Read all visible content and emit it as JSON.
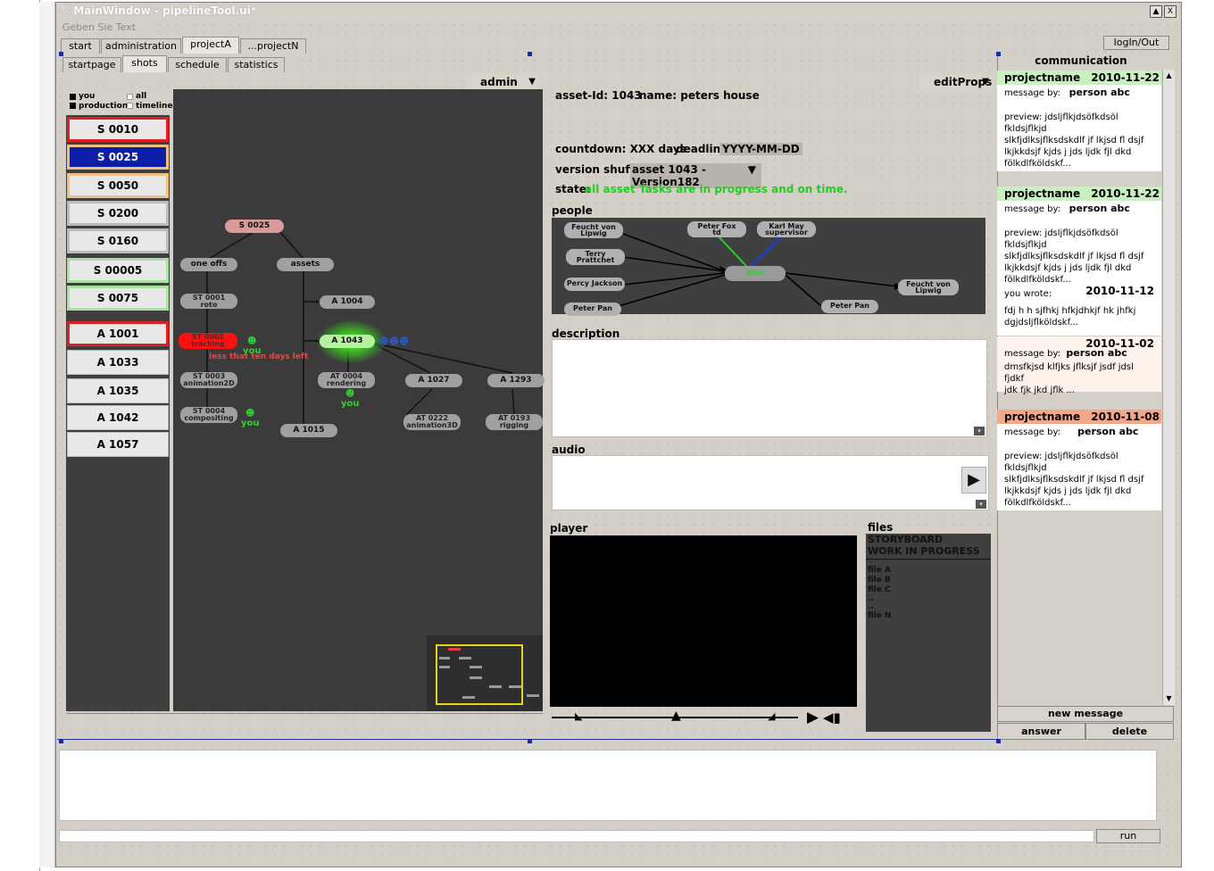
{
  "window": {
    "title": "MainWindow - pipelineTool.ui*",
    "top_lineedit_placeholder": "Geben Sie Text ein",
    "min_btn": "▲",
    "close_btn": "X"
  },
  "project_tabs": [
    "start",
    "administration",
    "projectA",
    "...projectN"
  ],
  "login_button": "logIn/Out",
  "sub_tabs": [
    "startpage",
    "shots",
    "schedule",
    "statistics"
  ],
  "legend": {
    "you": "you",
    "all": "all",
    "production": "production",
    "timeline": "timeline"
  },
  "shots": [
    {
      "label": "S 0010",
      "border": "#e02020",
      "bg": "#e8e8e8",
      "color": "#000"
    },
    {
      "label": "S 0025",
      "border": "#f0c080",
      "bg": "#0a1ea8",
      "color": "#ffffff"
    },
    {
      "label": "S 0050",
      "border": "#f0c080",
      "bg": "#e8e8e8",
      "color": "#000"
    },
    {
      "label": "S 0200",
      "border": "#bbbbbb",
      "bg": "#e8e8e8",
      "color": "#000"
    },
    {
      "label": "S 0160",
      "border": "#bbbbbb",
      "bg": "#e8e8e8",
      "color": "#000"
    },
    {
      "label": "S 00005",
      "border": "#a8e0a0",
      "bg": "#e8e8e8",
      "color": "#000"
    },
    {
      "label": "S 0075",
      "border": "#a8e0a0",
      "bg": "#e8e8e8",
      "color": "#000"
    }
  ],
  "assets": [
    {
      "label": "A 1001",
      "border": "#e02020"
    },
    {
      "label": "A 1033",
      "border": "#bbbbbb"
    },
    {
      "label": "A 1035",
      "border": "#bbbbbb"
    },
    {
      "label": "A 1042",
      "border": "#bbbbbb"
    },
    {
      "label": "A 1057",
      "border": "#bbbbbb"
    }
  ],
  "graph": {
    "admin_combo": "admin",
    "nodes": {
      "s0025": "S 0025",
      "one_offs": "one offs",
      "assets": "assets",
      "st0001": [
        "ST 0001",
        "roto"
      ],
      "st0002": [
        "ST 0002",
        "tracking"
      ],
      "st0003": [
        "ST 0003",
        "animation2D"
      ],
      "st0004": [
        "ST 0004",
        "compositing"
      ],
      "a1004": "A 1004",
      "a1043": "A 1043",
      "at0004": [
        "AT 0004",
        "rendering"
      ],
      "a1015": "A 1015",
      "a1027": "A 1027",
      "a1293": "A 1293",
      "at0222": [
        "AT 0222",
        "animation3D"
      ],
      "at0193": [
        "AT 0193",
        "rigging"
      ]
    },
    "you_label": "you",
    "warning": "less that ten days left"
  },
  "details": {
    "editprops_combo": "editProps",
    "asset_id": "asset-Id: 1043",
    "name": "name: peters house",
    "countdown": "countdown: XXX days",
    "deadline_label": "deadline:",
    "deadline_value": "YYYY-MM-DD",
    "version_label": "version shuffle:",
    "version_value": "asset 1043 -Version182",
    "state_label": "state:",
    "state_value": "all asset Tasks are in progress and on time.",
    "state_color": "#22cc22"
  },
  "people": {
    "title": "people",
    "nodes": {
      "feucht_left": [
        "Feucht von",
        "Lipwig"
      ],
      "terry": [
        "Terry",
        "Prattchet"
      ],
      "percy": "Percy Jackson",
      "peterpan_left": "Peter Pan",
      "peterfox": [
        "Peter Fox",
        "td"
      ],
      "karlmay": [
        "Karl May",
        "supervisor"
      ],
      "you": "you",
      "feucht_right": [
        "Feucht von",
        "Lipwig"
      ],
      "peterpan_right": "Peter Pan"
    }
  },
  "description_label": "description",
  "audio_label": "audio",
  "player_label": "player",
  "files": {
    "title": "files",
    "storyboard": "STORYBOARD",
    "wip": "WORK IN PROGRESS",
    "list": [
      "file A",
      "file B",
      "file C",
      "..",
      "..",
      "file N"
    ]
  },
  "communication": {
    "title": "communication",
    "messages": [
      {
        "project": "projectname",
        "date": "2010-11-22",
        "header_bg": "#c8f0c0",
        "by_label": "message by:",
        "person": "person abc",
        "preview": [
          "preview: jdsljflkjdsöfkdsöl fkldsjflkjd",
          "slkfjdlksjflksdskdlf jf lkjsd fl dsjf",
          "lkjkkdsjf kjds  j jds ljdk fjl dkd",
          "fölkdlfköldskf..."
        ]
      },
      {
        "project": "projectname",
        "date": "2010-11-22",
        "header_bg": "#c8f0c0",
        "by_label": "message by:",
        "person": "person abc",
        "preview": [
          "preview: jdsljflkjdsöfkdsöl fkldsjflkjd",
          "slkfjdlksjflksdskdlf jf lkjsd fl dsjf",
          "lkjkkdsjf kjds  j jds ljdk fjl dkd",
          "fölkdlfköldskf..."
        ]
      },
      {
        "date": "2010-11-12",
        "wrote": "you wrote:",
        "text": [
          "fdj h h sjfhkj hfkjdhkjf hk  jhfkj",
          "dgjdsljflköldskf..."
        ]
      },
      {
        "date": "2010-11-02",
        "by_label": "message by:",
        "person": "person abc",
        "text": [
          "dmsfkjsd klfjks jflksjf jsdf jdsl fjdkf",
          "jdk fjk jkd jflk ..."
        ]
      },
      {
        "project": "projectname",
        "date": "2010-11-08",
        "header_bg": "#f4a888",
        "by_label": "message by:",
        "person": "person abc",
        "preview": [
          "preview: jdsljflkjdsöfkdsöl fkldsjflkjd",
          "slkfjdlksjflksdskdlf jf lkjsd fl dsjf",
          "lkjkkdsjf kjds  j jds ljdk fjl dkd",
          "fölkdlfköldskf..."
        ]
      }
    ],
    "new_message": "new message",
    "answer": "answer",
    "delete": "delete"
  },
  "run_button": "run"
}
